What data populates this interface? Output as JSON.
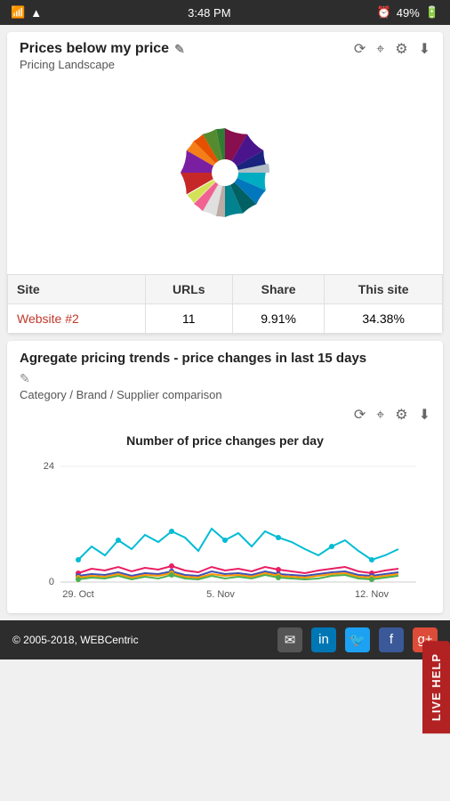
{
  "statusBar": {
    "time": "3:48 PM",
    "battery": "49%"
  },
  "card1": {
    "title": "Prices below my price",
    "subtitle": "Pricing Landscape",
    "editIcon": "✎",
    "refreshIcon": "⟳",
    "targetIcon": "⌖",
    "settingsIcon": "⚙",
    "downloadIcon": "⬇",
    "table": {
      "headers": [
        "Site",
        "URLs",
        "Share",
        "This site"
      ],
      "rows": [
        {
          "site": "Website #2",
          "urls": "11",
          "share": "9.91%",
          "thisSite": "34.38%"
        }
      ]
    }
  },
  "card2": {
    "title": "Agregate pricing trends - price changes in last 15 days",
    "editIcon": "✎",
    "subtitle": "Category / Brand / Supplier comparison",
    "chartTitle": "Number of price changes per day",
    "yAxisMax": "24",
    "yAxisMin": "0",
    "xLabels": [
      "29. Oct",
      "5. Nov",
      "12. Nov"
    ],
    "refreshIcon": "⟳",
    "targetIcon": "⌖",
    "settingsIcon": "⚙",
    "downloadIcon": "⬇"
  },
  "footer": {
    "copyright": "© 2005-2018, WEBCentric"
  },
  "liveHelp": {
    "label": "LIVE HELP"
  },
  "pieColors": [
    "#1a237e",
    "#7b1fa2",
    "#c62828",
    "#e64a19",
    "#f9a825",
    "#558b2f",
    "#00695c",
    "#00838f",
    "#006064",
    "#0277bd",
    "#283593",
    "#4a148c",
    "#880e4f",
    "#bf360c",
    "#e65100",
    "#f57f17",
    "#33691e",
    "#1b5e20",
    "#004d40"
  ]
}
